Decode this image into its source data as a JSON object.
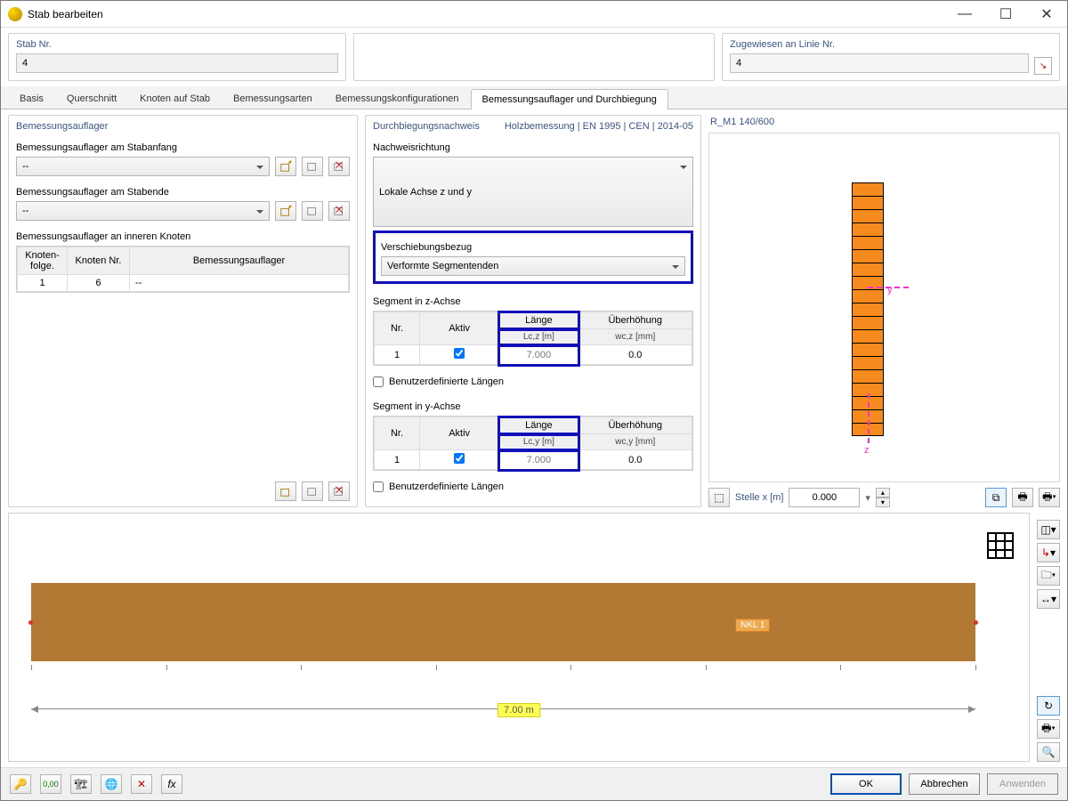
{
  "window": {
    "title": "Stab bearbeiten"
  },
  "header": {
    "member_no_label": "Stab Nr.",
    "member_no": "4",
    "assigned_label": "Zugewiesen an Linie Nr.",
    "assigned_value": "4"
  },
  "tabs": [
    "Basis",
    "Querschnitt",
    "Knoten auf Stab",
    "Bemessungsarten",
    "Bemessungskonfigurationen",
    "Bemessungsauflager und Durchbiegung"
  ],
  "active_tab": 5,
  "left": {
    "group_title": "Bemessungsauflager",
    "start_label": "Bemessungsauflager am Stabanfang",
    "end_label": "Bemessungsauflager am Stabende",
    "inner_label": "Bemessungsauflager an inneren Knoten",
    "dd_start": "--",
    "dd_end": "--",
    "table_headers": {
      "order": "Knoten-\nfolge.",
      "node": "Knoten\nNr.",
      "support": "Bemessungsauflager"
    },
    "rows": [
      {
        "order": "1",
        "node": "6",
        "support": "--"
      }
    ]
  },
  "mid": {
    "hdr_left": "Durchbiegungsnachweis",
    "hdr_right": "Holzbemessung | EN 1995 | CEN | 2014-05",
    "dir_label": "Nachweisrichtung",
    "dir_value": "Lokale Achse z und y",
    "disp_label": "Verschiebungsbezug",
    "disp_value": "Verformte Segmentenden",
    "seg_z_label": "Segment in z-Achse",
    "seg_y_label": "Segment in y-Achse",
    "col_nr": "Nr.",
    "col_active": "Aktiv",
    "col_len": "Länge",
    "col_len_z_sub": "Lc,z [m]",
    "col_len_y_sub": "Lc,y [m]",
    "col_camber": "Überhöhung",
    "col_camber_z_sub": "wc,z [mm]",
    "col_camber_y_sub": "wc,y [mm]",
    "seg_z_rows": [
      {
        "nr": "1",
        "active": true,
        "len": "7.000",
        "camber": "0.0"
      }
    ],
    "seg_y_rows": [
      {
        "nr": "1",
        "active": true,
        "len": "7.000",
        "camber": "0.0"
      }
    ],
    "user_len_label": "Benutzerdefinierte Längen"
  },
  "right": {
    "section_name": "R_M1 140/600",
    "pos_label": "Stelle x [m]",
    "pos_value": "0.000",
    "axis_y": "y",
    "axis_z": "z"
  },
  "render": {
    "nkl_label": "NKL 1",
    "dimension": "7.00 m"
  },
  "footer": {
    "ok": "OK",
    "cancel": "Abbrechen",
    "apply": "Anwenden"
  }
}
